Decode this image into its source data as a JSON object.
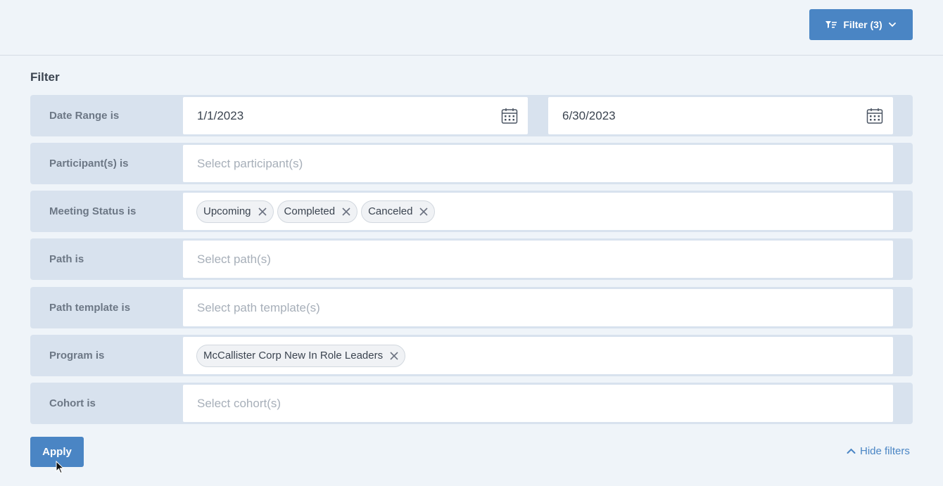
{
  "header": {
    "filter_button_label": "Filter (3)",
    "filter_icon": "filter-icon",
    "chevron_icon": "chevron-down-icon"
  },
  "filter": {
    "title": "Filter",
    "date_range": {
      "label": "Date Range is",
      "start": "1/1/2023",
      "end": "6/30/2023"
    },
    "participants": {
      "label": "Participant(s) is",
      "placeholder": "Select participant(s)"
    },
    "meeting_status": {
      "label": "Meeting Status is",
      "chips": [
        "Upcoming",
        "Completed",
        "Canceled"
      ]
    },
    "path": {
      "label": "Path is",
      "placeholder": "Select path(s)"
    },
    "path_template": {
      "label": "Path template is",
      "placeholder": "Select path template(s)"
    },
    "program": {
      "label": "Program is",
      "chips": [
        "McCallister Corp New In Role Leaders"
      ]
    },
    "cohort": {
      "label": "Cohort is",
      "placeholder": "Select cohort(s)"
    }
  },
  "actions": {
    "apply_label": "Apply",
    "hide_filters_label": "Hide filters"
  },
  "colors": {
    "accent": "#4a85c4",
    "background": "#eff4f9",
    "row_background": "#d8e2ee"
  }
}
